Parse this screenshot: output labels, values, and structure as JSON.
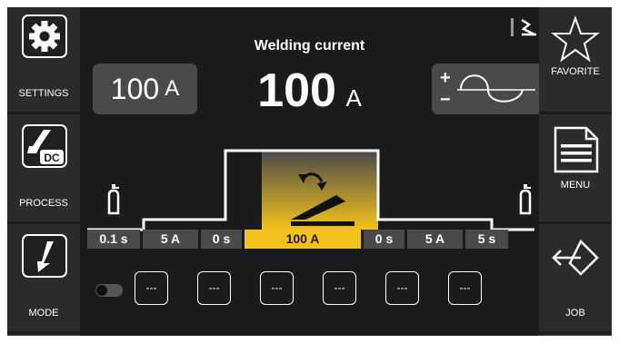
{
  "left_panel": {
    "settings_label": "SETTINGS",
    "process_label": "PROCESS",
    "process_badge": "DC",
    "mode_label": "MODE"
  },
  "right_panel": {
    "favorite_label": "FAVORITE",
    "menu_label": "MENU",
    "job_label": "JOB"
  },
  "main": {
    "title": "Welding current",
    "value": "100",
    "unit": "A",
    "setpoint_value": "100",
    "setpoint_unit": "A",
    "polarity_plus": "+",
    "polarity_minus": "−"
  },
  "params": [
    {
      "label": "0.1 s",
      "active": false
    },
    {
      "label": "5 A",
      "active": false
    },
    {
      "label": "0 s",
      "active": false
    },
    {
      "label": "100 A",
      "active": true
    },
    {
      "label": "0 s",
      "active": false
    },
    {
      "label": "5 A",
      "active": false
    },
    {
      "label": "5 s",
      "active": false
    }
  ],
  "job_slots": [
    "---",
    "---",
    "---",
    "---",
    "---",
    "---"
  ],
  "colors": {
    "accent": "#f4c21b",
    "panel": "#2b2b2b",
    "background": "#1b1b1b",
    "box": "#4a4a4a"
  },
  "icons": {
    "settings": "gear-icon",
    "process": "torch-icon",
    "mode": "trigger-icon",
    "favorite": "star-icon",
    "menu": "document-icon",
    "job": "load-diamond-icon",
    "gas": "gas-bottle-icon"
  }
}
